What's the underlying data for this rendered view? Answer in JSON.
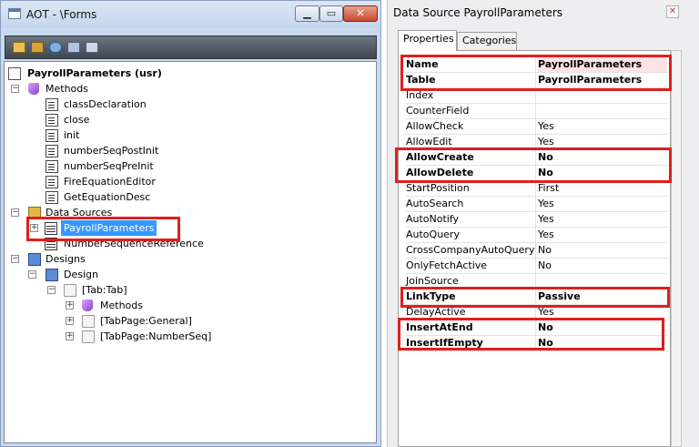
{
  "aot": {
    "title": "AOT - \\Forms",
    "buttons": {
      "minimize": "▁",
      "maximize": "▭",
      "close": "✕"
    },
    "tree": [
      {
        "label": "PayrollParameters (usr)",
        "bold": true
      },
      {
        "label": "Methods"
      },
      {
        "label": "classDeclaration"
      },
      {
        "label": "close"
      },
      {
        "label": "init"
      },
      {
        "label": "numberSeqPostInit"
      },
      {
        "label": "numberSeqPreInit"
      },
      {
        "label": "FireEquationEditor"
      },
      {
        "label": "GetEquationDesc"
      },
      {
        "label": "Data Sources"
      },
      {
        "label": "PayrollParameters",
        "selected": true
      },
      {
        "label": "NumberSequenceReference"
      },
      {
        "label": "Designs"
      },
      {
        "label": "Design"
      },
      {
        "label": "[Tab:Tab]"
      },
      {
        "label": "Methods"
      },
      {
        "label": "[TabPage:General]"
      },
      {
        "label": "[TabPage:NumberSeq]"
      }
    ]
  },
  "props": {
    "title": "Data Source PayrollParameters",
    "close": "✕",
    "tabs": [
      "Properties",
      "Categories"
    ],
    "rows": [
      {
        "name": "Name",
        "value": "PayrollParameters",
        "bold": true
      },
      {
        "name": "Table",
        "value": "PayrollParameters",
        "bold": true
      },
      {
        "name": "Index",
        "value": ""
      },
      {
        "name": "CounterField",
        "value": ""
      },
      {
        "name": "AllowCheck",
        "value": "Yes"
      },
      {
        "name": "AllowEdit",
        "value": "Yes"
      },
      {
        "name": "AllowCreate",
        "value": "No",
        "bold": true
      },
      {
        "name": "AllowDelete",
        "value": "No",
        "bold": true
      },
      {
        "name": "StartPosition",
        "value": "First"
      },
      {
        "name": "AutoSearch",
        "value": "Yes"
      },
      {
        "name": "AutoNotify",
        "value": "Yes"
      },
      {
        "name": "AutoQuery",
        "value": "Yes"
      },
      {
        "name": "CrossCompanyAutoQuery",
        "value": "No"
      },
      {
        "name": "OnlyFetchActive",
        "value": "No"
      },
      {
        "name": "JoinSource",
        "value": ""
      },
      {
        "name": "LinkType",
        "value": "Passive",
        "bold": true
      },
      {
        "name": "DelayActive",
        "value": "Yes"
      },
      {
        "name": "InsertAtEnd",
        "value": "No",
        "bold": true
      },
      {
        "name": "InsertIfEmpty",
        "value": "No",
        "bold": true
      }
    ]
  }
}
